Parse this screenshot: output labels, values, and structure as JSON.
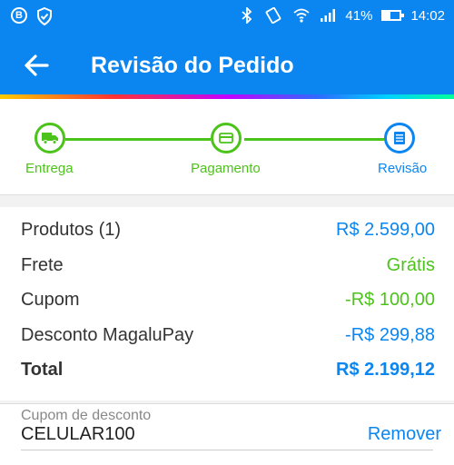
{
  "status_bar": {
    "battery": "41%",
    "time": "14:02",
    "left_icons": [
      "b-badge-icon",
      "shield-check-icon"
    ],
    "right_icons": [
      "bluetooth-icon",
      "vibrate-icon",
      "wifi-icon",
      "signal-icon",
      "battery-icon"
    ]
  },
  "header": {
    "title": "Revisão do Pedido",
    "back_icon": "arrow-left-icon"
  },
  "stepper": {
    "steps": [
      {
        "label": "Entrega",
        "icon": "truck-icon",
        "state": "done"
      },
      {
        "label": "Pagamento",
        "icon": "card-icon",
        "state": "done"
      },
      {
        "label": "Revisão",
        "icon": "list-icon",
        "state": "active"
      }
    ]
  },
  "summary": {
    "rows": [
      {
        "label": "Produtos (1)",
        "value": "R$ 2.599,00"
      },
      {
        "label": "Frete",
        "value": "Grátis"
      },
      {
        "label": "Cupom",
        "value": "-R$ 100,00"
      },
      {
        "label": "Desconto MagaluPay",
        "value": "-R$ 299,88"
      },
      {
        "label": "Total",
        "value": "R$ 2.199,12"
      }
    ]
  },
  "coupon": {
    "label": "Cupom de desconto",
    "code": "CELULAR100",
    "remove_label": "Remover"
  },
  "colors": {
    "primary": "#0b86f0",
    "success": "#4cc31a"
  }
}
